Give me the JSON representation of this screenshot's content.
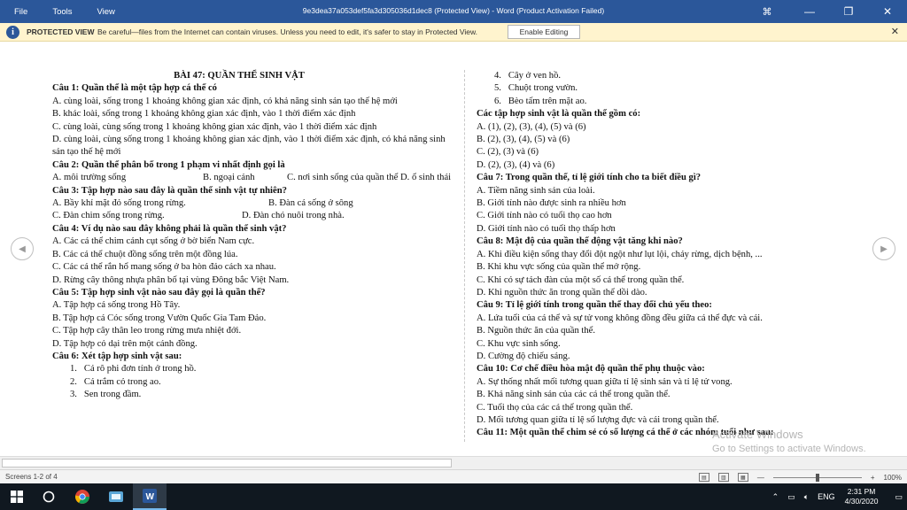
{
  "titlebar": {
    "menu": [
      "File",
      "Tools",
      "View"
    ],
    "title": "9e3dea37a053def5fa3d305036d1dec8 (Protected View) - Word (Product Activation Failed)",
    "controls": {
      "ribbon": "⌘",
      "minimize": "—",
      "restore": "❐",
      "close": "✕"
    }
  },
  "protected_bar": {
    "icon": "i",
    "label": "PROTECTED VIEW",
    "message": "Be careful—files from the Internet can contain viruses. Unless you need to edit, it's safer to stay in Protected View.",
    "button": "Enable Editing",
    "close": "✕"
  },
  "document": {
    "left": [
      "BÀI 47: QUẦN THỂ SINH VẬT",
      "Câu 1: Quần thể là một tập hợp cá thể có",
      "A. cùng loài, sống trong 1 khoảng không gian xác định, có khả năng sinh sản tạo thế hệ mới",
      "B. khác loài, sống trong 1 khoảng không gian xác định, vào 1 thời điểm xác định",
      "C. cùng loài, cùng sống trong 1 khoảng không gian xác định, vào 1 thời điểm xác định",
      "D. cùng loài, cùng sống trong 1 khoảng không gian xác định, vào 1 thời điểm xác định, có khả năng sinh sản tạo thế hệ mới",
      "Câu 2: Quần thể phân bố trong 1 phạm vi nhất định gọi là",
      "A. môi trường sống",
      "B. ngoại cảnh",
      "C. nơi sinh sống của quần thể",
      "D. ổ sinh thái",
      "Câu 3: Tập hợp nào sau đây là quần thể sinh vật tự nhiên?",
      "A. Bầy khỉ mặt đỏ sống trong rừng.",
      "B. Đàn cá sống ở sông",
      "C. Đàn chim sống trong rừng.",
      "D. Đàn chó nuôi trong nhà.",
      "Câu 4: Ví dụ nào sau đây không phải là quần thể sinh vật?",
      "A. Các cá thể chim cánh cụt sống ở bờ biển Nam cực.",
      "B. Các cá thể chuột đồng sống trên một đồng lúa.",
      "C. Các cá thể rắn hổ mang sống ở ba hòn đảo cách xa nhau.",
      "D. Rừng cây thông nhựa phân bố tại vùng Đông bắc Việt Nam.",
      "Câu 5: Tập hợp sinh vật nào sau đây gọi là quần thể?",
      "A. Tập hợp cá sống trong Hồ Tây.",
      "B. Tập hợp cá Cóc sống trong Vườn Quốc Gia Tam Đảo.",
      "C. Tập hợp cây thân leo trong rừng mưa nhiệt đới.",
      "D. Tập hợp cỏ dại trên một cánh đồng.",
      "Câu 6: Xét tập hợp sinh vật sau:",
      "1.   Cá rô phi đơn tính ở trong hồ.",
      "2.   Cá trắm cỏ trong ao.",
      "3.   Sen trong đầm."
    ],
    "right": [
      "4.   Cây ở ven hồ.",
      "5.   Chuột trong vườn.",
      "6.   Bèo tấm trên mặt ao.",
      "Các tập hợp sinh vật là quần thể gồm có:",
      "A. (1), (2), (3), (4), (5) và (6)",
      "B. (2), (3), (4), (5) và (6)",
      "C. (2), (3) và (6)",
      "D. (2), (3), (4) và (6)",
      "Câu 7: Trong quần thể, tỉ lệ giới tính cho ta biết điều gì?",
      "A. Tiềm năng sinh sản của loài.",
      "B. Giới tính nào được sinh ra nhiều hơn",
      "C. Giới tính nào có tuổi thọ cao hơn",
      "D. Giới tính nào có tuổi thọ thấp hơn",
      "Câu 8: Mật độ của quần thể động vật tăng khi nào?",
      "A. Khi điều kiện sống thay đổi đột ngột như lụt lội, cháy rừng, dịch bệnh, ...",
      "B. Khi khu vực sống của quần thể mở rộng.",
      "C. Khi có sự tách đàn của một số cá thể trong quần thể.",
      "D. Khi nguồn thức ăn trong quần thể dồi dào.",
      "Câu 9: Tỉ lệ giới tính trong quần thể thay đổi chủ yếu theo:",
      "A. Lứa tuổi của cá thể và sự tử vong không đồng đều giữa cá thể đực và cái.",
      "B. Nguồn thức ăn của quần thể.",
      "C. Khu vực sinh sống.",
      "D. Cường độ chiếu sáng.",
      "Câu 10: Cơ chế điều hòa mật độ quần thể phụ thuộc vào:",
      "A. Sự thống nhất mối tương quan giữa tỉ lệ sinh sản và tỉ lệ tử vong.",
      "B. Khả năng sinh sản của các cá thể trong quần thể.",
      "C. Tuổi thọ của các cá thể trong quần thể.",
      "D. Mối tương quan giữa tỉ lệ số lượng đực và cái trong quần thể.",
      "Câu 11: Một quần thể chim sẻ có số lượng cá thể ở các nhóm tuổi như sau:"
    ]
  },
  "watermark": {
    "line1": "Activate Windows",
    "line2": "Go to Settings to activate Windows."
  },
  "statusbar": {
    "screens": "Screens 1-2 of 4",
    "zoom": "100%",
    "minus": "—",
    "plus": "+"
  },
  "taskbar": {
    "start_icon": "windows-logo",
    "lang": "ENG",
    "time": "2:31 PM",
    "date": "4/30/2020"
  },
  "colors": {
    "titlebar": "#2b579a",
    "protected_bar": "#fff4ce",
    "taskbar": "#101820"
  }
}
